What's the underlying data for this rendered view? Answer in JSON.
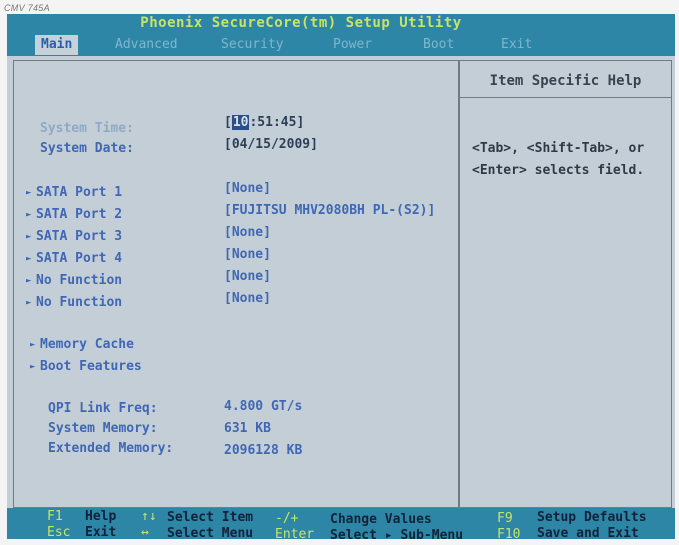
{
  "bezel": {
    "model": "CMV 745A"
  },
  "title": "Phoenix SecureCore(tm) Setup Utility",
  "menu": [
    "Main",
    "Advanced",
    "Security",
    "Power",
    "Boot",
    "Exit"
  ],
  "main": {
    "system_time": {
      "label": "System Time:",
      "hour": "10",
      "rest": ":51:45]",
      "open": "["
    },
    "system_date": {
      "label": "System Date:",
      "value": "[04/15/2009]"
    },
    "submenus": [
      {
        "label": "SATA Port 1",
        "value": "[None]"
      },
      {
        "label": "SATA Port 2",
        "value": "[FUJITSU MHV2080BH PL-(S2)]"
      },
      {
        "label": "SATA Port 3",
        "value": "[None]"
      },
      {
        "label": "SATA Port 4",
        "value": "[None]"
      },
      {
        "label": "No Function",
        "value": "[None]"
      },
      {
        "label": "No Function",
        "value": "[None]"
      }
    ],
    "memory_cache": "Memory Cache",
    "boot_features": "Boot Features",
    "info": [
      {
        "label": "QPI Link Freq:",
        "value": "4.800 GT/s"
      },
      {
        "label": "System Memory:",
        "value": "631 KB"
      },
      {
        "label": "Extended Memory:",
        "value": "2096128 KB"
      }
    ]
  },
  "help": {
    "title": "Item Specific Help",
    "line1": "<Tab>, <Shift-Tab>, or",
    "line2": "<Enter> selects field."
  },
  "footer": {
    "f1_key": "F1",
    "f1_text": "Help",
    "updown_key": "↑↓",
    "updown_text": "Select Item",
    "pm_key": "-/+",
    "pm_text": "Change Values",
    "f9_key": "F9",
    "f9_text": "Setup Defaults",
    "esc_key": "Esc",
    "esc_text": "Exit",
    "lr_key": "↔",
    "lr_text": "Select Menu",
    "enter_key": "Enter",
    "enter_text": "Select ▸ Sub-Menu",
    "f10_key": "F10",
    "f10_text": "Save and Exit"
  }
}
